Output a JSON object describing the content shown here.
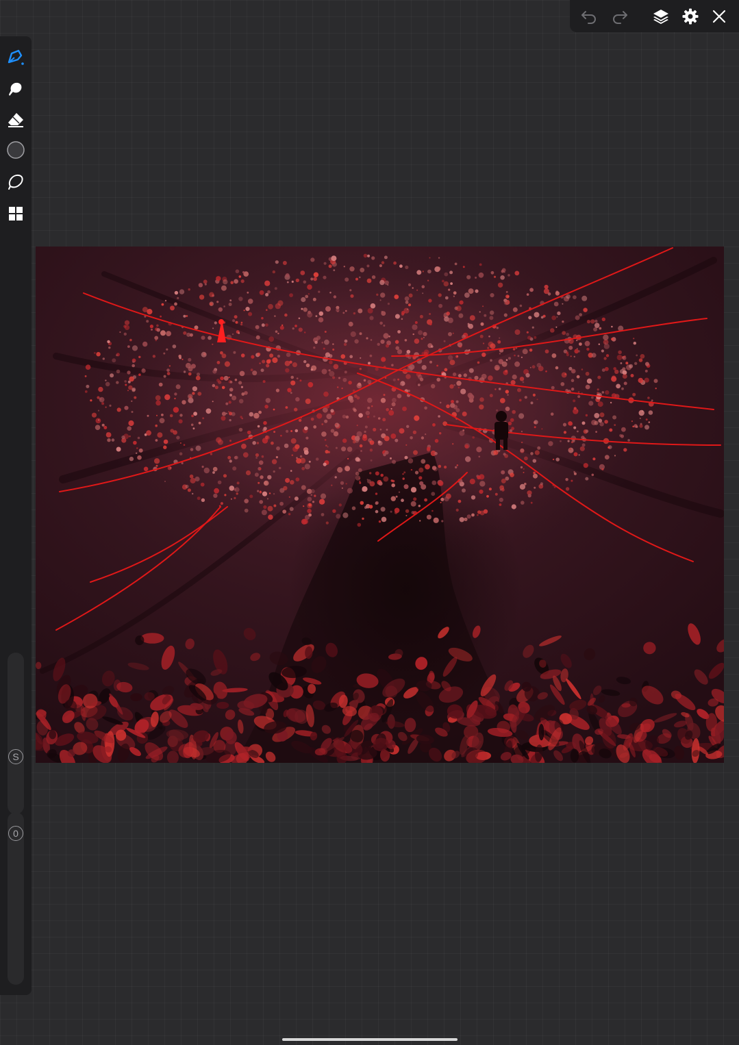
{
  "app": {
    "top_toolbar": {
      "buttons": [
        {
          "icon": "undo-icon",
          "enabled": false
        },
        {
          "icon": "redo-icon",
          "enabled": false
        },
        {
          "icon": "layers-icon",
          "enabled": true
        },
        {
          "icon": "settings-icon",
          "enabled": true
        },
        {
          "icon": "close-icon",
          "enabled": true
        }
      ]
    },
    "sidebar": {
      "tools": [
        {
          "icon": "brush-icon",
          "selected": true
        },
        {
          "icon": "smudge-icon",
          "selected": false
        },
        {
          "icon": "eraser-icon",
          "selected": false
        },
        {
          "icon": "color-swatch-icon",
          "selected": false
        },
        {
          "icon": "selection-icon",
          "selected": false
        },
        {
          "icon": "gallery-grid-icon",
          "selected": false
        }
      ],
      "size_slider": {
        "label": "S"
      },
      "opacity_slider": {
        "label": "0"
      }
    },
    "colors": {
      "accent": "#1e90ff",
      "background": "#2b2b2d",
      "panel": "#1e1e20",
      "artwork_base": "#2e1219",
      "artwork_red": "#e01818"
    }
  }
}
